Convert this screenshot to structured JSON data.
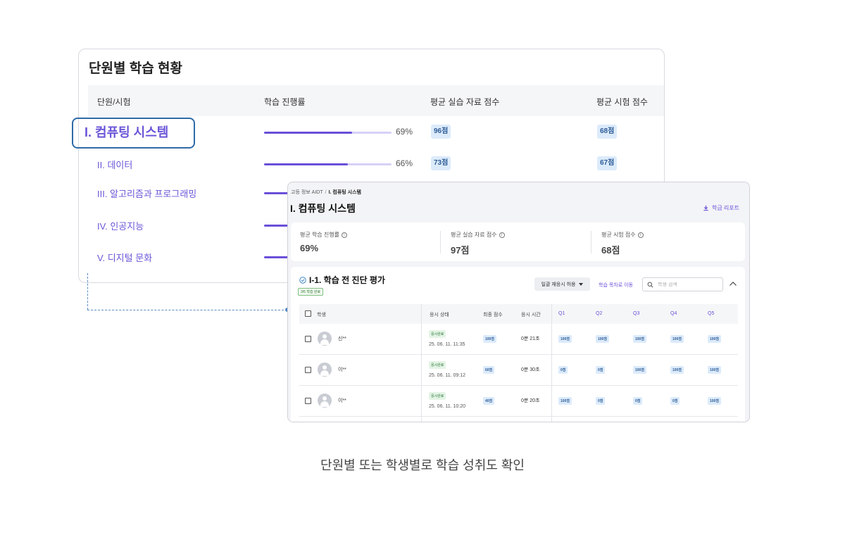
{
  "unit_card": {
    "title": "단원별 학습 현황",
    "headers": {
      "unit": "단원/시험",
      "progress": "학습 진행률",
      "practice": "평균 실습 자료 점수",
      "exam": "평균 시험 점수"
    },
    "rows": [
      {
        "label": "I. 컴퓨팅 시스템",
        "progress": 69,
        "progress_text": "69%",
        "practice": "96점",
        "exam": "68점",
        "selected": true
      },
      {
        "label": "II. 데이터",
        "progress": 66,
        "progress_text": "66%",
        "practice": "73점",
        "exam": "67점"
      },
      {
        "label": "III. 알고리즘과 프로그래밍",
        "progress": 70
      },
      {
        "label": "IV. 인공지능",
        "progress": 70
      },
      {
        "label": "V. 디지털 문화",
        "progress": 70
      }
    ]
  },
  "detail": {
    "breadcrumb": {
      "root": "고등 정보 AIDT",
      "sep": "/",
      "current": "I. 컴퓨팅 시스템"
    },
    "title": "I. 컴퓨팅 시스템",
    "report_label": "학급 리포트",
    "summary": [
      {
        "label": "평균 학습 진행률",
        "value": "69%"
      },
      {
        "label": "평균 실습 자료 점수",
        "value": "97점"
      },
      {
        "label": "평균 시험 점수",
        "value": "68점"
      }
    ],
    "section": {
      "title": "I-1. 학습 전 진단 평가",
      "badge": "3/5 학습 완료",
      "dropdown": "일괄 재응시 허용",
      "goto_link": "학습 목차로 이동",
      "search_placeholder": "학생 검색",
      "columns": {
        "student": "학생",
        "status": "응시 상태",
        "score": "최종 점수",
        "time": "응시 시간",
        "q": [
          "Q1",
          "Q2",
          "Q3",
          "Q4",
          "Q5"
        ]
      },
      "students": [
        {
          "name": "신**",
          "status": "응시완료",
          "datetime": "25. 06. 11. 11:35",
          "score": "100점",
          "time": "0분 21초",
          "q": [
            "100점",
            "100점",
            "100점",
            "100점",
            "100점"
          ]
        },
        {
          "name": "이**",
          "status": "응시완료",
          "datetime": "25. 06. 11. 09:12",
          "score": "60점",
          "time": "0분 30초",
          "q": [
            "0점",
            "0점",
            "100점",
            "100점",
            "100점"
          ]
        },
        {
          "name": "이**",
          "status": "응시완료",
          "datetime": "25. 06. 11. 10:20",
          "score": "40점",
          "time": "0분 20초",
          "q": [
            "100점",
            "0점",
            "0점",
            "0점",
            "100점"
          ]
        }
      ]
    }
  },
  "caption": "단원별 또는 학생별로 학습 성취도 확인",
  "colors": {
    "accent": "#6a4fd8",
    "highlight_border": "#2f6aa8",
    "badge_bg": "#dcebfb"
  }
}
